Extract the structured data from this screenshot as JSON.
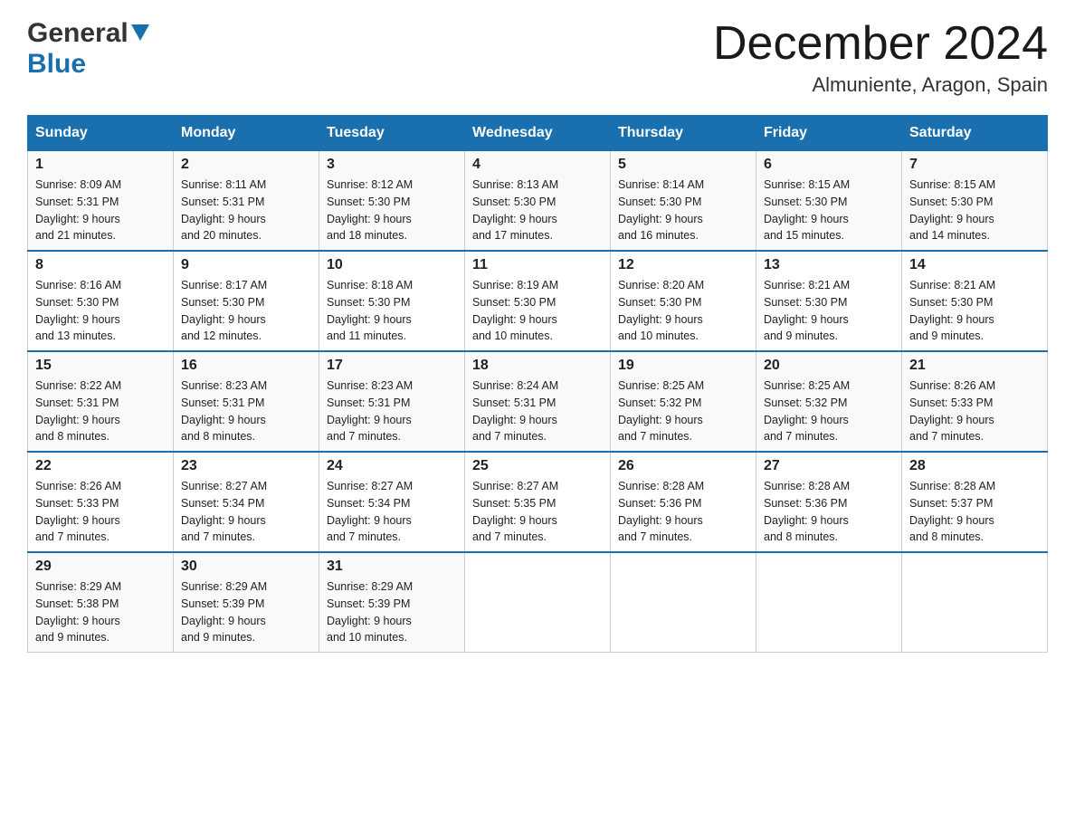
{
  "logo": {
    "general": "General",
    "blue": "Blue",
    "arrow": "▼"
  },
  "title": {
    "month_year": "December 2024",
    "location": "Almuniente, Aragon, Spain"
  },
  "days_of_week": [
    "Sunday",
    "Monday",
    "Tuesday",
    "Wednesday",
    "Thursday",
    "Friday",
    "Saturday"
  ],
  "weeks": [
    [
      {
        "day": "1",
        "sunrise": "8:09 AM",
        "sunset": "5:31 PM",
        "daylight": "9 hours and 21 minutes."
      },
      {
        "day": "2",
        "sunrise": "8:11 AM",
        "sunset": "5:31 PM",
        "daylight": "9 hours and 20 minutes."
      },
      {
        "day": "3",
        "sunrise": "8:12 AM",
        "sunset": "5:30 PM",
        "daylight": "9 hours and 18 minutes."
      },
      {
        "day": "4",
        "sunrise": "8:13 AM",
        "sunset": "5:30 PM",
        "daylight": "9 hours and 17 minutes."
      },
      {
        "day": "5",
        "sunrise": "8:14 AM",
        "sunset": "5:30 PM",
        "daylight": "9 hours and 16 minutes."
      },
      {
        "day": "6",
        "sunrise": "8:15 AM",
        "sunset": "5:30 PM",
        "daylight": "9 hours and 15 minutes."
      },
      {
        "day": "7",
        "sunrise": "8:15 AM",
        "sunset": "5:30 PM",
        "daylight": "9 hours and 14 minutes."
      }
    ],
    [
      {
        "day": "8",
        "sunrise": "8:16 AM",
        "sunset": "5:30 PM",
        "daylight": "9 hours and 13 minutes."
      },
      {
        "day": "9",
        "sunrise": "8:17 AM",
        "sunset": "5:30 PM",
        "daylight": "9 hours and 12 minutes."
      },
      {
        "day": "10",
        "sunrise": "8:18 AM",
        "sunset": "5:30 PM",
        "daylight": "9 hours and 11 minutes."
      },
      {
        "day": "11",
        "sunrise": "8:19 AM",
        "sunset": "5:30 PM",
        "daylight": "9 hours and 10 minutes."
      },
      {
        "day": "12",
        "sunrise": "8:20 AM",
        "sunset": "5:30 PM",
        "daylight": "9 hours and 10 minutes."
      },
      {
        "day": "13",
        "sunrise": "8:21 AM",
        "sunset": "5:30 PM",
        "daylight": "9 hours and 9 minutes."
      },
      {
        "day": "14",
        "sunrise": "8:21 AM",
        "sunset": "5:30 PM",
        "daylight": "9 hours and 9 minutes."
      }
    ],
    [
      {
        "day": "15",
        "sunrise": "8:22 AM",
        "sunset": "5:31 PM",
        "daylight": "9 hours and 8 minutes."
      },
      {
        "day": "16",
        "sunrise": "8:23 AM",
        "sunset": "5:31 PM",
        "daylight": "9 hours and 8 minutes."
      },
      {
        "day": "17",
        "sunrise": "8:23 AM",
        "sunset": "5:31 PM",
        "daylight": "9 hours and 7 minutes."
      },
      {
        "day": "18",
        "sunrise": "8:24 AM",
        "sunset": "5:31 PM",
        "daylight": "9 hours and 7 minutes."
      },
      {
        "day": "19",
        "sunrise": "8:25 AM",
        "sunset": "5:32 PM",
        "daylight": "9 hours and 7 minutes."
      },
      {
        "day": "20",
        "sunrise": "8:25 AM",
        "sunset": "5:32 PM",
        "daylight": "9 hours and 7 minutes."
      },
      {
        "day": "21",
        "sunrise": "8:26 AM",
        "sunset": "5:33 PM",
        "daylight": "9 hours and 7 minutes."
      }
    ],
    [
      {
        "day": "22",
        "sunrise": "8:26 AM",
        "sunset": "5:33 PM",
        "daylight": "9 hours and 7 minutes."
      },
      {
        "day": "23",
        "sunrise": "8:27 AM",
        "sunset": "5:34 PM",
        "daylight": "9 hours and 7 minutes."
      },
      {
        "day": "24",
        "sunrise": "8:27 AM",
        "sunset": "5:34 PM",
        "daylight": "9 hours and 7 minutes."
      },
      {
        "day": "25",
        "sunrise": "8:27 AM",
        "sunset": "5:35 PM",
        "daylight": "9 hours and 7 minutes."
      },
      {
        "day": "26",
        "sunrise": "8:28 AM",
        "sunset": "5:36 PM",
        "daylight": "9 hours and 7 minutes."
      },
      {
        "day": "27",
        "sunrise": "8:28 AM",
        "sunset": "5:36 PM",
        "daylight": "9 hours and 8 minutes."
      },
      {
        "day": "28",
        "sunrise": "8:28 AM",
        "sunset": "5:37 PM",
        "daylight": "9 hours and 8 minutes."
      }
    ],
    [
      {
        "day": "29",
        "sunrise": "8:29 AM",
        "sunset": "5:38 PM",
        "daylight": "9 hours and 9 minutes."
      },
      {
        "day": "30",
        "sunrise": "8:29 AM",
        "sunset": "5:39 PM",
        "daylight": "9 hours and 9 minutes."
      },
      {
        "day": "31",
        "sunrise": "8:29 AM",
        "sunset": "5:39 PM",
        "daylight": "9 hours and 10 minutes."
      },
      null,
      null,
      null,
      null
    ]
  ],
  "labels": {
    "sunrise": "Sunrise:",
    "sunset": "Sunset:",
    "daylight": "Daylight:"
  }
}
